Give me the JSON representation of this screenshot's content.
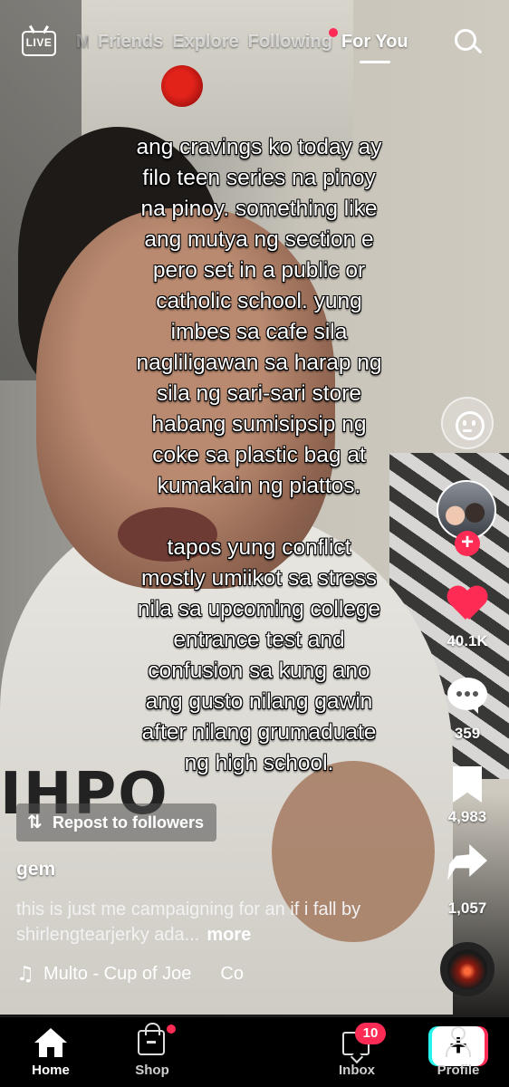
{
  "top_nav": {
    "live_label": "LIVE",
    "tabs": [
      {
        "label": "M",
        "icon": ""
      },
      {
        "label": "Friends"
      },
      {
        "label": "Explore"
      },
      {
        "label": "Following",
        "has_dot": true
      },
      {
        "label": "For You",
        "active": true
      }
    ],
    "search_icon": "search-icon"
  },
  "video": {
    "overlay_paragraphs": [
      "ang cravings ko today ay\nfilo teen series na pinoy\nna pinoy. something like\nang mutya ng section e\npero set in a public or\ncatholic school. yung\nimbes sa cafe sila\nnagliligawan sa harap ng\nsila ng sari-sari store\nhabang sumisipsip ng\ncoke sa plastic bag at\nkumakain ng piattos.",
      "tapos yung conflict\nmostly umiikot sa stress\nnila sa  upcoming college\nentrance test and\nconfusion sa kung ano\nang gusto nilang gawin\nafter nilang grumaduate\nng high school."
    ],
    "shirt_print": "IHPO"
  },
  "actions": {
    "likes": "40.1K",
    "comments": "359",
    "bookmarks": "4,983",
    "shares": "1,057",
    "like_color": "#fe2c55"
  },
  "post": {
    "repost_label": "Repost to followers",
    "username": "gem",
    "caption": "this is just me campaigning for an if i fall by shirlengtearjerky ada...",
    "more_label": "more",
    "music": "Multo - Cup of Joe",
    "music_extra": "Co"
  },
  "tab_bar": {
    "home": "Home",
    "shop": "Shop",
    "create": "+",
    "inbox": "Inbox",
    "inbox_badge": "10",
    "profile": "Profile"
  },
  "colors": {
    "accent": "#fe2c55",
    "create_left": "#25f4ee",
    "background": "#000000"
  }
}
